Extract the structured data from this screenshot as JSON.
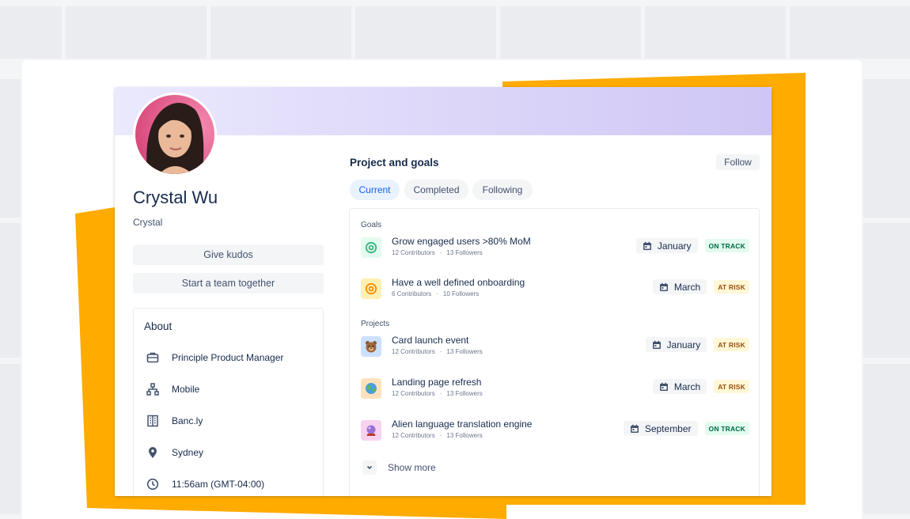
{
  "profile": {
    "name": "Crystal Wu",
    "handle": "Crystal",
    "give_kudos_label": "Give kudos",
    "start_team_label": "Start a team together"
  },
  "about": {
    "title": "About",
    "items": [
      {
        "icon": "briefcase-icon",
        "text": "Principle Product Manager"
      },
      {
        "icon": "org-chart-icon",
        "text": "Mobile"
      },
      {
        "icon": "office-building-icon",
        "text": "Banc.ly"
      },
      {
        "icon": "location-pin-icon",
        "text": "Sydney"
      },
      {
        "icon": "clock-icon",
        "text": "11:56am (GMT-04:00)"
      }
    ]
  },
  "projects_panel": {
    "title": "Project and goals",
    "follow_label": "Follow",
    "tabs": [
      {
        "label": "Current",
        "active": true
      },
      {
        "label": "Completed",
        "active": false
      },
      {
        "label": "Following",
        "active": false
      }
    ],
    "goals_label": "Goals",
    "projects_label": "Projects",
    "goals": [
      {
        "title": "Grow engaged users >80% MoM",
        "contributors": "12 Contributors",
        "followers": "13 Followers",
        "date": "January",
        "status": "ON TRACK",
        "icon": "target-icon",
        "icon_color": "#36b37e",
        "icon_bg": "#e3fcef"
      },
      {
        "title": "Have a well defined onboarding",
        "contributors": "6 Contributors",
        "followers": "10 Followers",
        "date": "March",
        "status": "AT RISK",
        "icon": "target-icon",
        "icon_color": "#ff8b00",
        "icon_bg": "#fff0b3"
      }
    ],
    "projects": [
      {
        "title": "Card launch event",
        "contributors": "12 Contributors",
        "followers": "13 Followers",
        "date": "January",
        "status": "AT RISK",
        "icon": "bear-emoji-icon",
        "icon_bg": "#cce0ff"
      },
      {
        "title": "Landing page refresh",
        "contributors": "12 Contributors",
        "followers": "13 Followers",
        "date": "March",
        "status": "AT RISK",
        "icon": "globe-emoji-icon",
        "icon_bg": "#ffe2bd"
      },
      {
        "title": "Alien language translation engine",
        "contributors": "12 Contributors",
        "followers": "13 Followers",
        "date": "September",
        "status": "ON TRACK",
        "icon": "crystal-ball-emoji-icon",
        "icon_bg": "#f8d3f0"
      }
    ],
    "show_more_label": "Show more"
  },
  "colors": {
    "accent_blue": "#0c66e4",
    "orange": "#ffab00",
    "on_track_green": "#006644",
    "at_risk_orange": "#974f0c"
  }
}
